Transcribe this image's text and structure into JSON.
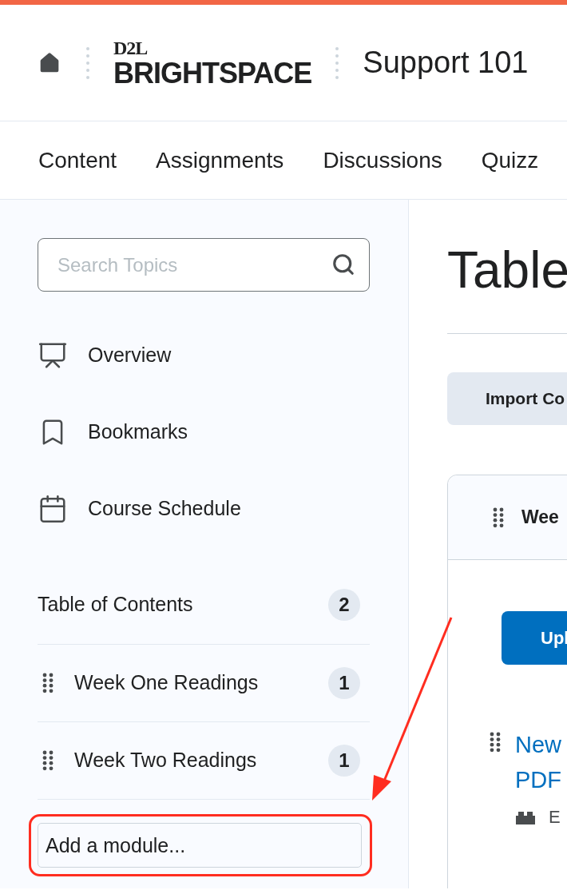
{
  "header": {
    "logo_top": "D2L",
    "logo_bottom": "BRIGHTSPACE",
    "course_title": "Support 101"
  },
  "nav": [
    {
      "label": "Content"
    },
    {
      "label": "Assignments"
    },
    {
      "label": "Discussions"
    },
    {
      "label": "Quizz"
    }
  ],
  "sidebar": {
    "search": {
      "placeholder": "Search Topics"
    },
    "links": [
      {
        "kind": "overview",
        "label": "Overview"
      },
      {
        "kind": "bookmarks",
        "label": "Bookmarks"
      },
      {
        "kind": "schedule",
        "label": "Course Schedule"
      }
    ],
    "toc": {
      "title": "Table of Contents",
      "count": "2"
    },
    "modules": [
      {
        "title": "Week One Readings",
        "count": "1"
      },
      {
        "title": "Week Two Readings",
        "count": "1"
      }
    ],
    "add_module": {
      "placeholder": "Add a module..."
    }
  },
  "main": {
    "title": "Table",
    "import_button": "Import Co",
    "card": {
      "title": "Wee",
      "upload_button": "Upl",
      "item": {
        "title_lines": [
          "New",
          "PDF"
        ],
        "meta": "E"
      }
    }
  }
}
